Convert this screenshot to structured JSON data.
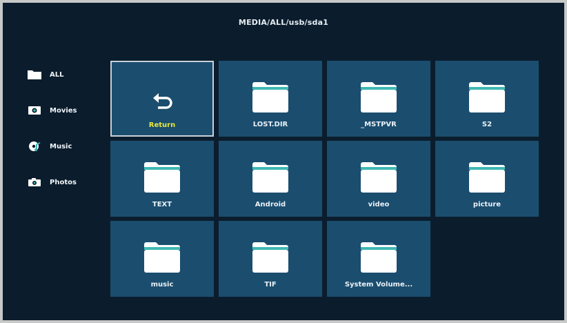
{
  "header": {
    "path": "MEDIA/ALL/usb/sda1"
  },
  "sidebar": {
    "items": [
      {
        "label": "ALL",
        "icon": "folder-icon"
      },
      {
        "label": "Movies",
        "icon": "movie-icon"
      },
      {
        "label": "Music",
        "icon": "music-icon"
      },
      {
        "label": "Photos",
        "icon": "camera-icon"
      }
    ]
  },
  "grid": {
    "tiles": [
      {
        "label": "Return",
        "icon": "return-icon",
        "selected": true
      },
      {
        "label": "LOST.DIR",
        "icon": "folder-icon"
      },
      {
        "label": "_MSTPVR",
        "icon": "folder-icon"
      },
      {
        "label": "S2",
        "icon": "folder-icon"
      },
      {
        "label": "TEXT",
        "icon": "folder-icon"
      },
      {
        "label": "Android",
        "icon": "folder-icon"
      },
      {
        "label": "video",
        "icon": "folder-icon"
      },
      {
        "label": "picture",
        "icon": "folder-icon"
      },
      {
        "label": "music",
        "icon": "folder-icon"
      },
      {
        "label": "TIF",
        "icon": "folder-icon"
      },
      {
        "label": "System Volume...",
        "icon": "folder-icon"
      }
    ]
  },
  "colors": {
    "background": "#0b1d2d",
    "tile": "#1b4d6e",
    "selected_label": "#e6e93c",
    "folder_tab": "#3fb8b3",
    "folder_body": "#ffffff"
  }
}
